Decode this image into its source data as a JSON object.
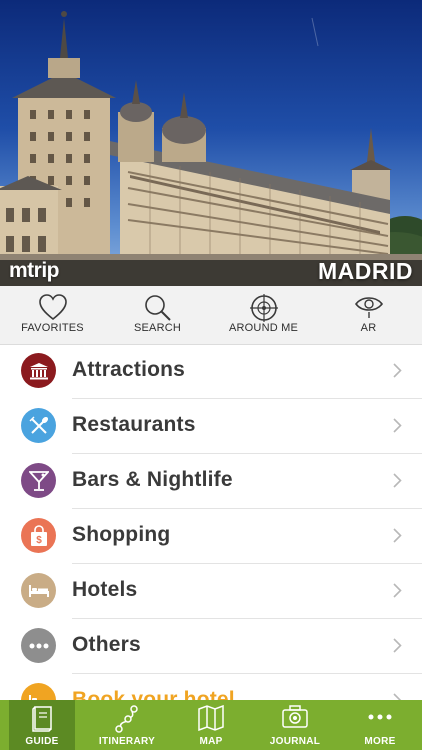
{
  "hero": {
    "brand": "mtrip",
    "city": "MADRID"
  },
  "quick_actions": [
    {
      "label": "FAVORITES",
      "icon": "heart-icon"
    },
    {
      "label": "SEARCH",
      "icon": "search-icon"
    },
    {
      "label": "AROUND ME",
      "icon": "target-icon"
    },
    {
      "label": "AR",
      "icon": "eye-icon"
    }
  ],
  "categories": [
    {
      "label": "Attractions",
      "icon": "museum-icon",
      "color": "#8b1a1e"
    },
    {
      "label": "Restaurants",
      "icon": "fork-knife-icon",
      "color": "#4aa3df"
    },
    {
      "label": "Bars & Nightlife",
      "icon": "cocktail-icon",
      "color": "#7e4a86"
    },
    {
      "label": "Shopping",
      "icon": "shopping-bag-icon",
      "color": "#ea7455"
    },
    {
      "label": "Hotels",
      "icon": "bed-icon",
      "color": "#c9ac86"
    },
    {
      "label": "Others",
      "icon": "more-dots-icon",
      "color": "#8e8e8e"
    },
    {
      "label": "Book your hotel",
      "icon": "hotel-booking-icon",
      "color": "#f0a422"
    }
  ],
  "tabs": [
    {
      "label": "GUIDE",
      "icon": "book-icon",
      "active": true
    },
    {
      "label": "ITINERARY",
      "icon": "route-icon",
      "active": false
    },
    {
      "label": "MAP",
      "icon": "map-icon",
      "active": false
    },
    {
      "label": "JOURNAL",
      "icon": "camera-icon",
      "active": false
    },
    {
      "label": "MORE",
      "icon": "more-dots-icon",
      "active": false
    }
  ],
  "colors": {
    "tab_bar": "#7cae2f",
    "tab_active": "#5c8a23",
    "book_accent": "#f0a422"
  }
}
